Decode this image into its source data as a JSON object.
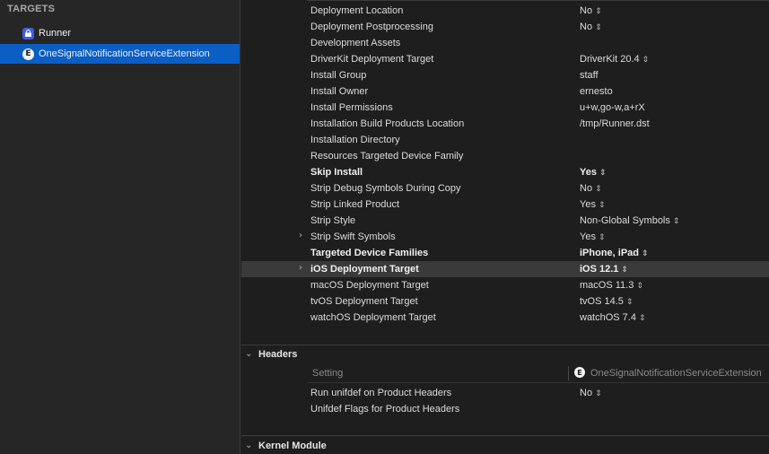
{
  "sidebar": {
    "header": "TARGETS",
    "targets": [
      {
        "label": "Runner",
        "icon": "app-target-icon",
        "selected": false
      },
      {
        "label": "OneSignalNotificationServiceExtension",
        "icon": "extension-target-icon",
        "selected": true
      }
    ]
  },
  "settings": [
    {
      "name": "Deployment Location",
      "value": "No",
      "stepper": true
    },
    {
      "name": "Deployment Postprocessing",
      "value": "No",
      "stepper": true
    },
    {
      "name": "Development Assets",
      "value": ""
    },
    {
      "name": "DriverKit Deployment Target",
      "value": "DriverKit 20.4",
      "stepper": true
    },
    {
      "name": "Install Group",
      "value": "staff"
    },
    {
      "name": "Install Owner",
      "value": "ernesto"
    },
    {
      "name": "Install Permissions",
      "value": "u+w,go-w,a+rX"
    },
    {
      "name": "Installation Build Products Location",
      "value": "/tmp/Runner.dst"
    },
    {
      "name": "Installation Directory",
      "value": ""
    },
    {
      "name": "Resources Targeted Device Family",
      "value": ""
    },
    {
      "name": "Skip Install",
      "value": "Yes",
      "stepper": true,
      "bold": true
    },
    {
      "name": "Strip Debug Symbols During Copy",
      "value": "No",
      "stepper": true
    },
    {
      "name": "Strip Linked Product",
      "value": "Yes",
      "stepper": true
    },
    {
      "name": "Strip Style",
      "value": "Non-Global Symbols",
      "stepper": true
    },
    {
      "name": "Strip Swift Symbols",
      "value": "Yes",
      "stepper": true,
      "disclosure": true
    },
    {
      "name": "Targeted Device Families",
      "value": "iPhone, iPad",
      "stepper": true,
      "bold": true
    },
    {
      "name": "iOS Deployment Target",
      "value": "iOS 12.1",
      "stepper": true,
      "bold": true,
      "disclosure": true,
      "highlighted": true
    },
    {
      "name": "macOS Deployment Target",
      "value": "macOS 11.3",
      "stepper": true
    },
    {
      "name": "tvOS Deployment Target",
      "value": "tvOS 14.5",
      "stepper": true
    },
    {
      "name": "watchOS Deployment Target",
      "value": "watchOS 7.4",
      "stepper": true
    }
  ],
  "headers_section": {
    "title": "Headers",
    "column_setting": "Setting",
    "column_target": "OneSignalNotificationServiceExtension",
    "rows": [
      {
        "name": "Run unifdef on Product Headers",
        "value": "No",
        "stepper": true
      },
      {
        "name": "Unifdef Flags for Product Headers",
        "value": ""
      }
    ]
  },
  "kernel_section": {
    "title": "Kernel Module"
  },
  "glyphs": {
    "stepper": "⇕",
    "disclosure_closed": "›",
    "disclosure_open": "⌄",
    "extension_letter": "E"
  }
}
